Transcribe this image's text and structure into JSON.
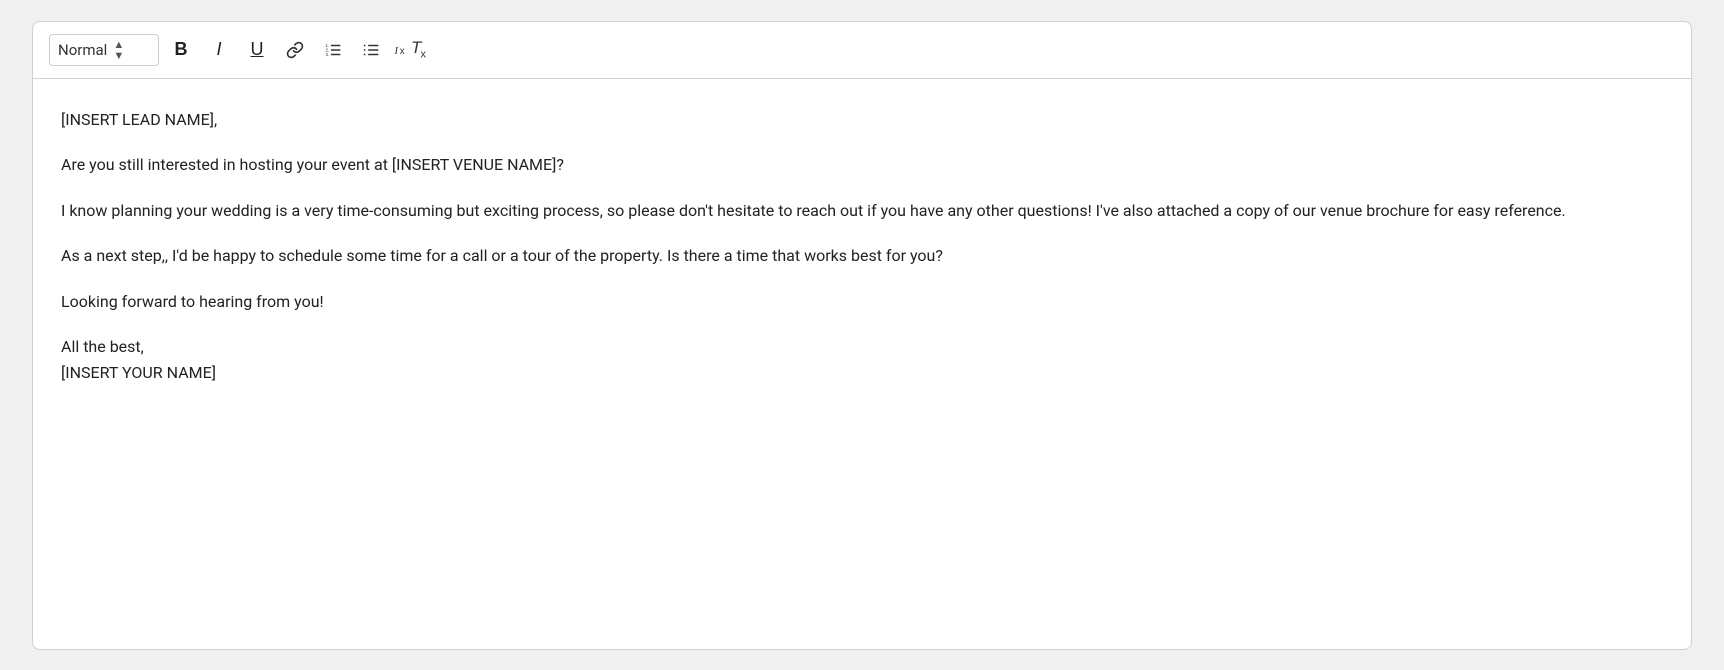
{
  "toolbar": {
    "style_label": "Normal",
    "bold_label": "B",
    "italic_label": "I",
    "underline_label": "U",
    "ordered_list_label": "≡",
    "unordered_list_label": "≡",
    "clear_format_label": "clear format"
  },
  "content": {
    "line1": "[INSERT LEAD NAME],",
    "line2": "Are you still interested in hosting your event at [INSERT VENUE NAME]?",
    "line3": "I know planning your wedding is a very time-consuming but exciting process, so please don't hesitate to reach out if you have any other questions! I've also attached a copy of our venue brochure for easy reference.",
    "line4": "As a next step,, I'd be happy to schedule some time for a call or a tour of the property. Is there a time that works best for you?",
    "line5": "Looking forward to hearing from you!",
    "line6": "All the best,",
    "line7": "[INSERT YOUR NAME]"
  }
}
